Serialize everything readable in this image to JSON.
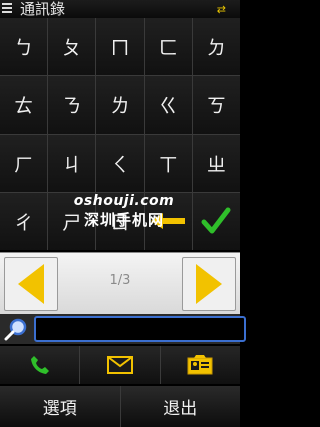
{
  "status_bar": {
    "title": "通訊錄"
  },
  "keypad": {
    "keys": [
      "ㄅ",
      "ㄆ",
      "ㄇ",
      "ㄈ",
      "ㄉ",
      "ㄊ",
      "ㄋ",
      "ㄌ",
      "ㄍ",
      "ㄎ",
      "ㄏ",
      "ㄐ",
      "ㄑ",
      "ㄒ",
      "ㄓ",
      "ㄔ",
      "ㄕ",
      "ㄖ"
    ],
    "backspace_icon": "arrow-left-icon",
    "ok_icon": "checkmark-icon"
  },
  "watermark": {
    "line1": "oshouji.com",
    "line2": "深圳手机网"
  },
  "pager": {
    "page_label": "1/3"
  },
  "search": {
    "value": "",
    "placeholder": ""
  },
  "actions": {
    "icons": [
      "phone-icon",
      "envelope-icon",
      "contact-card-icon"
    ]
  },
  "softkeys": {
    "left": "選項",
    "right": "退出"
  },
  "colors": {
    "accent_yellow": "#f2c200",
    "ok_green": "#2fbf2a",
    "search_border": "#3b6fd0"
  }
}
